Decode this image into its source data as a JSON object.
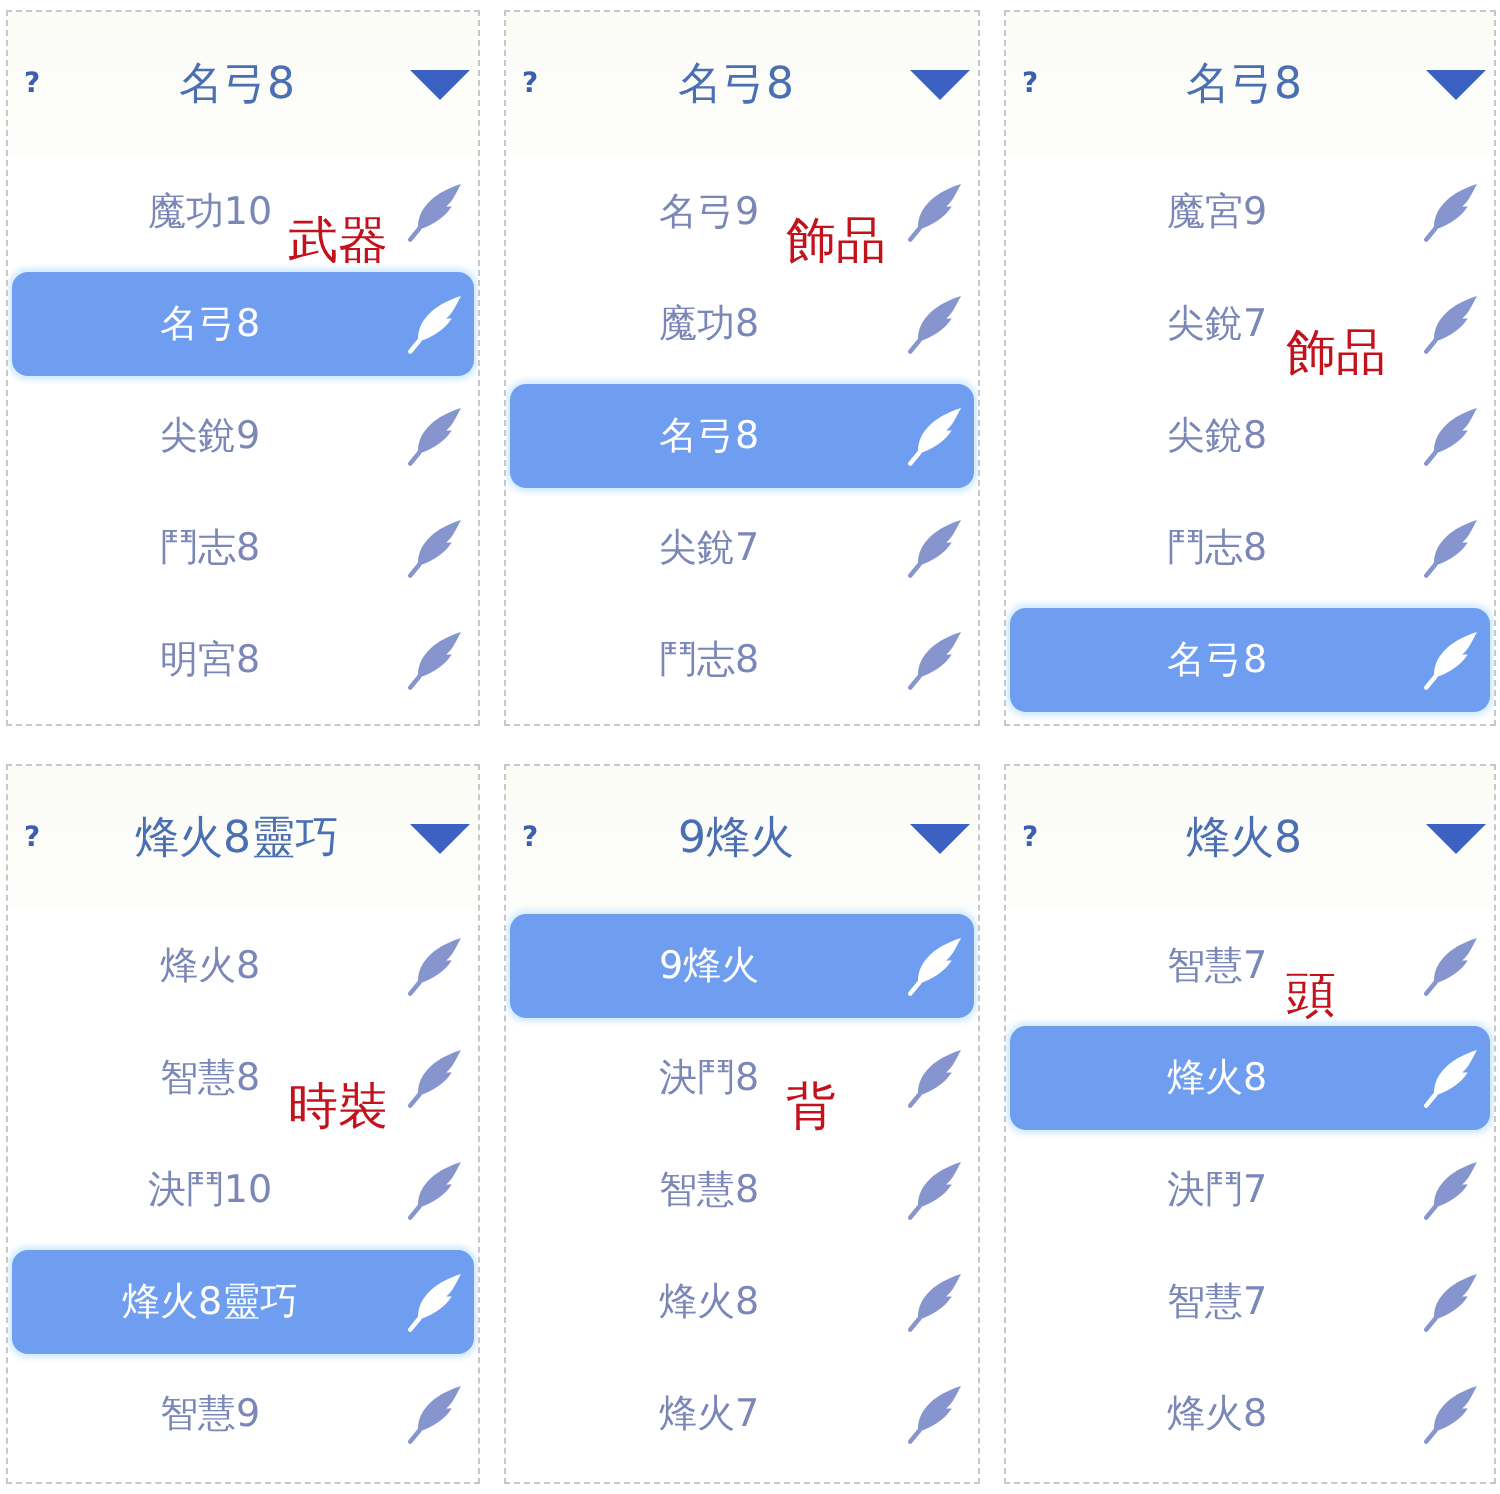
{
  "panels": [
    {
      "help": "?",
      "title": "名弓8",
      "options": [
        {
          "label": "魔功10",
          "selected": false,
          "annotation": "武器"
        },
        {
          "label": "名弓8",
          "selected": true
        },
        {
          "label": "尖銳9",
          "selected": false
        },
        {
          "label": "鬥志8",
          "selected": false
        },
        {
          "label": "明宮8",
          "selected": false
        }
      ]
    },
    {
      "help": "?",
      "title": "名弓8",
      "options": [
        {
          "label": "名弓9",
          "selected": false,
          "annotation": "飾品"
        },
        {
          "label": "魔功8",
          "selected": false
        },
        {
          "label": "名弓8",
          "selected": true
        },
        {
          "label": "尖銳7",
          "selected": false
        },
        {
          "label": "鬥志8",
          "selected": false
        }
      ]
    },
    {
      "help": "?",
      "title": "名弓8",
      "options": [
        {
          "label": "魔宮9",
          "selected": false
        },
        {
          "label": "尖銳7",
          "selected": false,
          "annotation": "飾品"
        },
        {
          "label": "尖銳8",
          "selected": false
        },
        {
          "label": "鬥志8",
          "selected": false
        },
        {
          "label": "名弓8",
          "selected": true
        }
      ]
    },
    {
      "help": "?",
      "title": "烽火8靈巧",
      "options": [
        {
          "label": "烽火8",
          "selected": false
        },
        {
          "label": "智慧8",
          "selected": false,
          "annotation": "時裝"
        },
        {
          "label": "決鬥10",
          "selected": false
        },
        {
          "label": "烽火8靈巧",
          "selected": true
        },
        {
          "label": "智慧9",
          "selected": false
        }
      ]
    },
    {
      "help": "?",
      "title": "9烽火",
      "options": [
        {
          "label": "9烽火",
          "selected": true
        },
        {
          "label": "決鬥8",
          "selected": false,
          "annotation": "背"
        },
        {
          "label": "智慧8",
          "selected": false
        },
        {
          "label": "烽火8",
          "selected": false
        },
        {
          "label": "烽火7",
          "selected": false
        }
      ]
    },
    {
      "help": "?",
      "title": "烽火8",
      "options": [
        {
          "label": "智慧7",
          "selected": false,
          "annotation": "頭"
        },
        {
          "label": "烽火8",
          "selected": true
        },
        {
          "label": "決鬥7",
          "selected": false
        },
        {
          "label": "智慧7",
          "selected": false
        },
        {
          "label": "烽火8",
          "selected": false
        }
      ]
    }
  ]
}
